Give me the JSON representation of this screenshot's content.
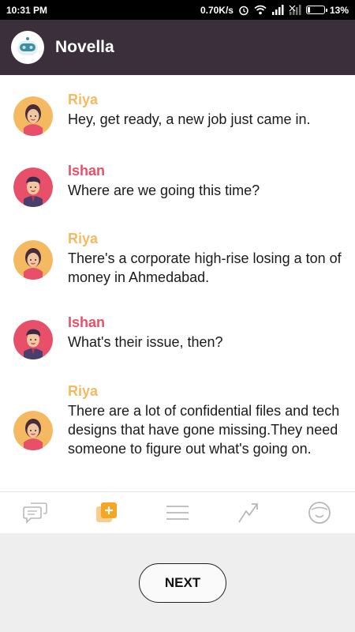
{
  "status_bar": {
    "time": "10:31 PM",
    "network_speed": "0.70K/s",
    "battery_percent": "13%",
    "battery_level": 0.13
  },
  "app_bar": {
    "title": "Novella",
    "logo_icon": "robot-face-icon"
  },
  "colors": {
    "app_bar": "#3b2f3b",
    "riya": "#f5b961",
    "ishan": "#e8506a"
  },
  "messages": [
    {
      "sender": "Riya",
      "text": "Hey, get ready, a new job just came in."
    },
    {
      "sender": "Ishan",
      "text": "Where are we going this time?"
    },
    {
      "sender": "Riya",
      "text": "There's a corporate high-rise losing a ton of money in Ahmedabad."
    },
    {
      "sender": "Ishan",
      "text": "What's their issue, then?"
    },
    {
      "sender": "Riya",
      "text": "There are a lot of confidential files and tech designs that have gone missing.They need someone to figure out what's going on."
    }
  ],
  "tabs": [
    {
      "icon": "chat-bubbles-icon",
      "active": false
    },
    {
      "icon": "add-story-icon",
      "active": true
    },
    {
      "icon": "menu-lines-icon",
      "active": false
    },
    {
      "icon": "trending-icon",
      "active": false
    },
    {
      "icon": "smiley-face-icon",
      "active": false
    }
  ],
  "footer": {
    "next_label": "NEXT"
  }
}
